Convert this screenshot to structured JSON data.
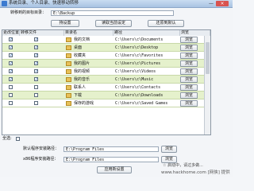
{
  "window": {
    "title": "系统目录、个人目录、快速移动转移",
    "minimize": "—",
    "close": "×"
  },
  "target_dir": {
    "label": "转移到的目标目录：",
    "value": "E:\\Backup"
  },
  "buttons": {
    "keep_settings": "持设置",
    "read_current": "读取当前设定",
    "restore_default": "还原到默认",
    "apply_settings": "应用新设置",
    "browse": "浏览",
    "browse_cell": "浏览"
  },
  "table": {
    "headers": [
      "更改位置",
      "转移文件",
      "目录名",
      "路径",
      "浏览"
    ],
    "rows": [
      {
        "change": "✓",
        "move": "✓",
        "name": "我的文档",
        "path": "C:\\Users\\c\\Documents"
      },
      {
        "change": "✓",
        "move": "✓",
        "name": "桌面",
        "path": "C:\\Users\\c\\Desktop"
      },
      {
        "change": "✓",
        "move": "✓",
        "name": "收藏夹",
        "path": "C:\\Users\\c\\Favorites"
      },
      {
        "change": "✓",
        "move": "✓",
        "name": "我的图片",
        "path": "C:\\Users\\c\\Pictures"
      },
      {
        "change": "✓",
        "move": "✓",
        "name": "我的视频",
        "path": "C:\\Users\\c\\Videos"
      },
      {
        "change": "✓",
        "move": "✓",
        "name": "我的音乐",
        "path": "C:\\Users\\c\\Music"
      },
      {
        "change": "",
        "move": "",
        "name": "联系人",
        "path": "C:\\Users\\c\\Contacts"
      },
      {
        "change": "",
        "move": "",
        "name": "下载",
        "path": "C:\\Users\\c\\Downloads"
      },
      {
        "change": "",
        "move": "",
        "name": "保存的游戏",
        "path": "C:\\Users\\c\\Saved Games"
      }
    ]
  },
  "select_all_label": "全选:",
  "program_files": {
    "label": "默认程序安装路径：",
    "value": "E:\\Program Files"
  },
  "program_files_x86": {
    "label": "x86程序安装路径：",
    "value": "E:\\Program Files"
  },
  "footer_note": "☆ 启动中，请过多做...",
  "watermark": "www.hackhome.com [网侠] 提供"
}
